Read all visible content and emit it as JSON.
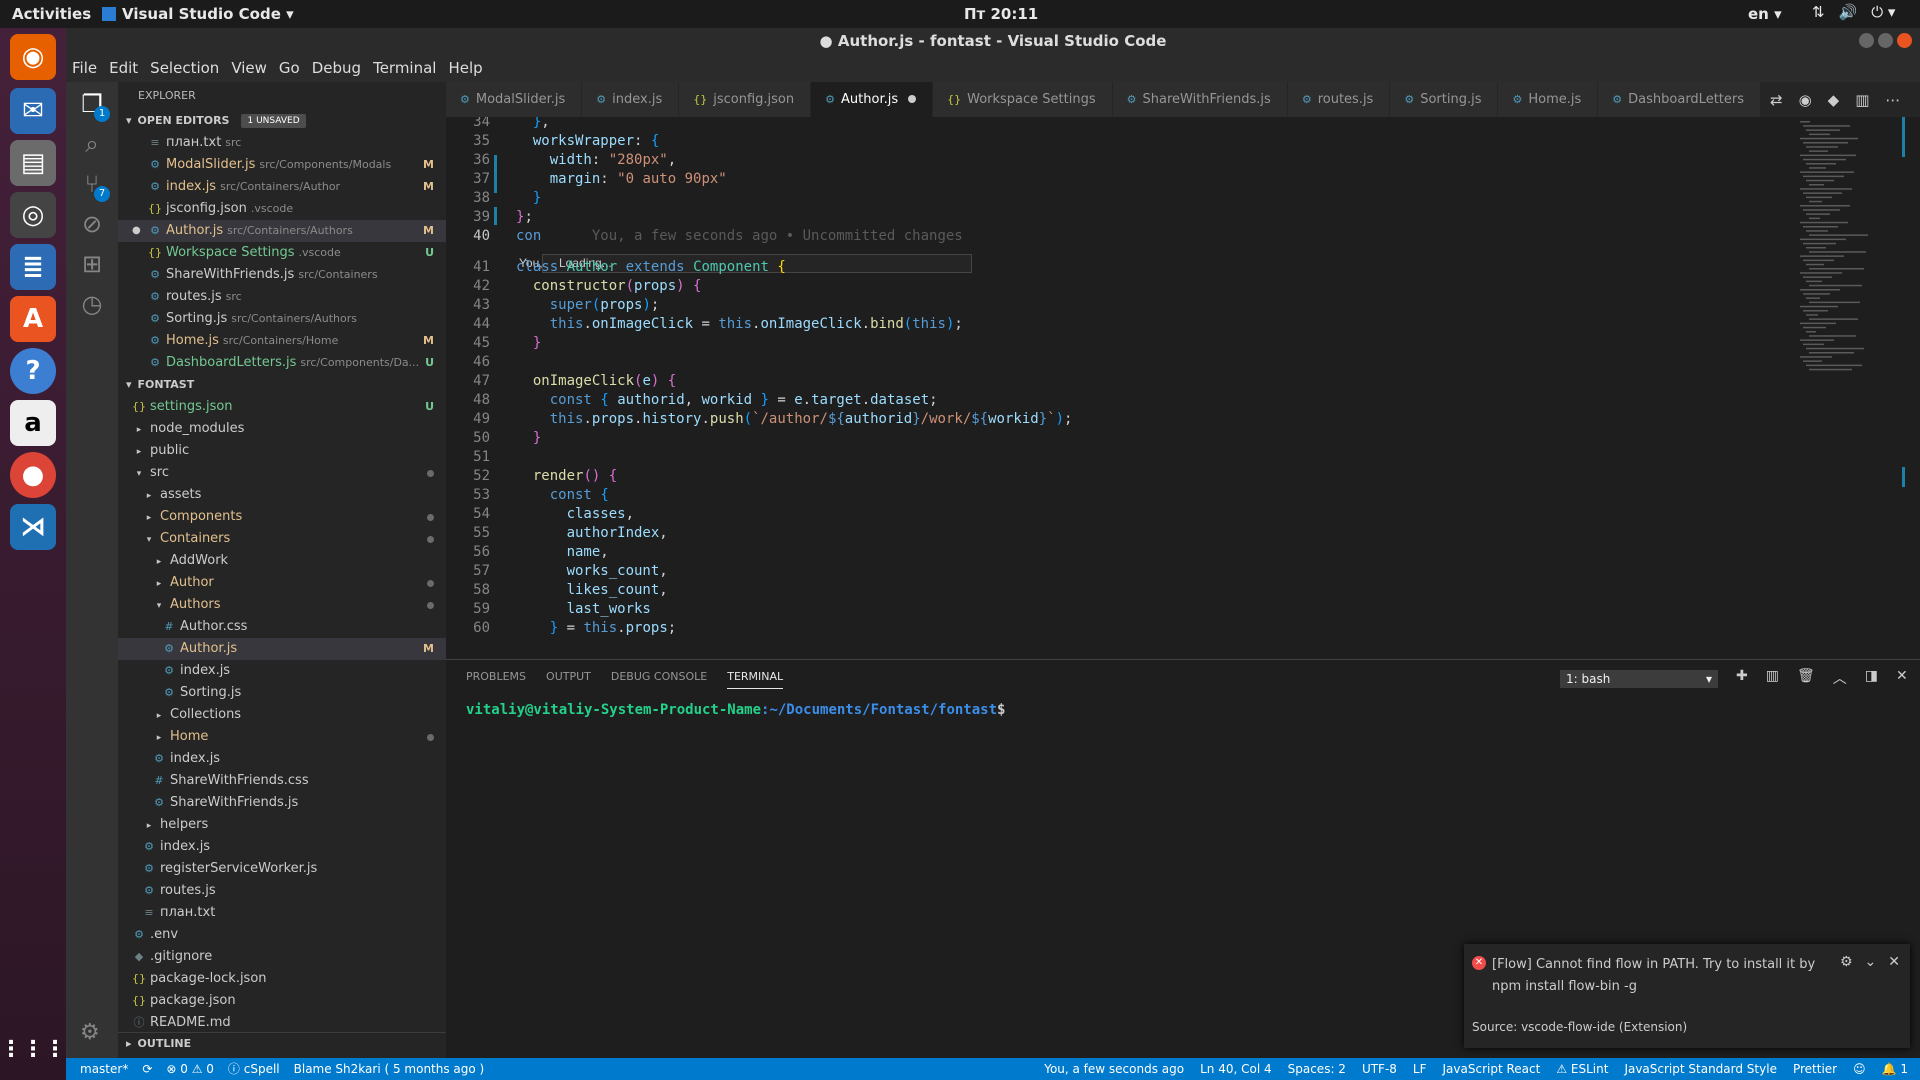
{
  "topbar": {
    "activities": "Activities",
    "app": "Visual Studio Code ▾",
    "clock": "Пт 20:11",
    "lang": "en ▾"
  },
  "window": {
    "title": "● Author.js - fontast - Visual Studio Code"
  },
  "menu": [
    "File",
    "Edit",
    "Selection",
    "View",
    "Go",
    "Debug",
    "Terminal",
    "Help"
  ],
  "activity": {
    "explorer_badge": "1",
    "scm_badge": "7"
  },
  "explorer": {
    "title": "EXPLORER",
    "open_editors_label": "OPEN EDITORS",
    "unsaved_badge": "1 UNSAVED",
    "open_editors": [
      {
        "icon": "≡",
        "name": "план.txt",
        "path": "src",
        "status": "",
        "cls": ""
      },
      {
        "icon": "⚙",
        "name": "ModalSlider.js",
        "path": "src/Components/Modals",
        "status": "M",
        "cls": "mod"
      },
      {
        "icon": "⚙",
        "name": "index.js",
        "path": "src/Containers/Author",
        "status": "M",
        "cls": "mod"
      },
      {
        "icon": "{}",
        "name": "jsconfig.json",
        "path": ".vscode",
        "status": "",
        "cls": ""
      },
      {
        "icon": "⚙",
        "name": "Author.js",
        "path": "src/Containers/Authors",
        "status": "M",
        "cls": "mod"
      },
      {
        "icon": "{}",
        "name": "Workspace Settings",
        "path": ".vscode",
        "status": "U",
        "cls": "unt"
      },
      {
        "icon": "⚙",
        "name": "ShareWithFriends.js",
        "path": "src/Containers",
        "status": "",
        "cls": ""
      },
      {
        "icon": "⚙",
        "name": "routes.js",
        "path": "src",
        "status": "",
        "cls": ""
      },
      {
        "icon": "⚙",
        "name": "Sorting.js",
        "path": "src/Containers/Authors",
        "status": "",
        "cls": ""
      },
      {
        "icon": "⚙",
        "name": "Home.js",
        "path": "src/Containers/Home",
        "status": "M",
        "cls": "mod"
      },
      {
        "icon": "⚙",
        "name": "DashboardLetters.js",
        "path": "src/Components/Da...",
        "status": "U",
        "cls": "unt"
      }
    ],
    "project_label": "FONTAST",
    "tree": [
      {
        "indent": 1,
        "icon": "{}",
        "name": "settings.json",
        "status": "U",
        "cls": "unt",
        "dot": false
      },
      {
        "indent": 1,
        "icon": "▸",
        "name": "node_modules",
        "status": "",
        "cls": "",
        "dot": false
      },
      {
        "indent": 1,
        "icon": "▸",
        "name": "public",
        "status": "",
        "cls": "",
        "dot": false
      },
      {
        "indent": 1,
        "icon": "▾",
        "name": "src",
        "status": "",
        "cls": "",
        "dot": true
      },
      {
        "indent": 2,
        "icon": "▸",
        "name": "assets",
        "status": "",
        "cls": "",
        "dot": false
      },
      {
        "indent": 2,
        "icon": "▸",
        "name": "Components",
        "status": "",
        "cls": "mod",
        "dot": true
      },
      {
        "indent": 2,
        "icon": "▾",
        "name": "Containers",
        "status": "",
        "cls": "mod",
        "dot": true
      },
      {
        "indent": 3,
        "icon": "▸",
        "name": "AddWork",
        "status": "",
        "cls": "",
        "dot": false
      },
      {
        "indent": 3,
        "icon": "▸",
        "name": "Author",
        "status": "",
        "cls": "mod",
        "dot": true
      },
      {
        "indent": 3,
        "icon": "▾",
        "name": "Authors",
        "status": "",
        "cls": "mod",
        "dot": true
      },
      {
        "indent": 4,
        "icon": "#",
        "name": "Author.css",
        "status": "",
        "cls": "",
        "dot": false
      },
      {
        "indent": 4,
        "icon": "⚙",
        "name": "Author.js",
        "status": "M",
        "cls": "mod",
        "dot": false
      },
      {
        "indent": 4,
        "icon": "⚙",
        "name": "index.js",
        "status": "",
        "cls": "",
        "dot": false
      },
      {
        "indent": 4,
        "icon": "⚙",
        "name": "Sorting.js",
        "status": "",
        "cls": "",
        "dot": false
      },
      {
        "indent": 3,
        "icon": "▸",
        "name": "Collections",
        "status": "",
        "cls": "",
        "dot": false
      },
      {
        "indent": 3,
        "icon": "▸",
        "name": "Home",
        "status": "",
        "cls": "mod",
        "dot": true
      },
      {
        "indent": 3,
        "icon": "⚙",
        "name": "index.js",
        "status": "",
        "cls": "",
        "dot": false
      },
      {
        "indent": 3,
        "icon": "#",
        "name": "ShareWithFriends.css",
        "status": "",
        "cls": "",
        "dot": false
      },
      {
        "indent": 3,
        "icon": "⚙",
        "name": "ShareWithFriends.js",
        "status": "",
        "cls": "",
        "dot": false
      },
      {
        "indent": 2,
        "icon": "▸",
        "name": "helpers",
        "status": "",
        "cls": "",
        "dot": false
      },
      {
        "indent": 2,
        "icon": "⚙",
        "name": "index.js",
        "status": "",
        "cls": "",
        "dot": false
      },
      {
        "indent": 2,
        "icon": "⚙",
        "name": "registerServiceWorker.js",
        "status": "",
        "cls": "",
        "dot": false
      },
      {
        "indent": 2,
        "icon": "⚙",
        "name": "routes.js",
        "status": "",
        "cls": "",
        "dot": false
      },
      {
        "indent": 2,
        "icon": "≡",
        "name": "план.txt",
        "status": "",
        "cls": "",
        "dot": false
      },
      {
        "indent": 1,
        "icon": "⚙",
        "name": ".env",
        "status": "",
        "cls": "",
        "dot": false
      },
      {
        "indent": 1,
        "icon": "◆",
        "name": ".gitignore",
        "status": "",
        "cls": "",
        "dot": false
      },
      {
        "indent": 1,
        "icon": "{}",
        "name": "package-lock.json",
        "status": "",
        "cls": "",
        "dot": false
      },
      {
        "indent": 1,
        "icon": "{}",
        "name": "package.json",
        "status": "",
        "cls": "",
        "dot": false
      },
      {
        "indent": 1,
        "icon": "ⓘ",
        "name": "README.md",
        "status": "",
        "cls": "",
        "dot": false
      }
    ],
    "outline_label": "OUTLINE"
  },
  "tabs": [
    {
      "icon": "⚙",
      "label": "ModalSlider.js",
      "active": false
    },
    {
      "icon": "⚙",
      "label": "index.js",
      "active": false
    },
    {
      "icon": "{}",
      "label": "jsconfig.json",
      "active": false
    },
    {
      "icon": "⚙",
      "label": "Author.js",
      "active": true
    },
    {
      "icon": "{}",
      "label": "Workspace Settings",
      "active": false
    },
    {
      "icon": "⚙",
      "label": "ShareWithFriends.js",
      "active": false
    },
    {
      "icon": "⚙",
      "label": "routes.js",
      "active": false
    },
    {
      "icon": "⚙",
      "label": "Sorting.js",
      "active": false
    },
    {
      "icon": "⚙",
      "label": "Home.js",
      "active": false
    },
    {
      "icon": "⚙",
      "label": "DashboardLetters",
      "active": false
    }
  ],
  "editor": {
    "current_line": 40,
    "lines": [
      {
        "n": 34,
        "html": "  <span class='br2'>}</span>,"
      },
      {
        "n": 35,
        "html": "  <span class='p'>worksWrapper</span>: <span class='br2'>{</span>"
      },
      {
        "n": 36,
        "html": "    <span class='p'>width</span>: <span class='s'>\"280px\"</span>,"
      },
      {
        "n": 37,
        "html": "    <span class='p'>margin</span>: <span class='s'>\"0 auto 90px\"</span>"
      },
      {
        "n": 38,
        "html": "  <span class='br2'>}</span>"
      },
      {
        "n": 39,
        "html": "<span class='br1'>}</span>;"
      },
      {
        "n": 40,
        "html": "<span class='k'>con</span>      <span class='ghost'>You, a few seconds ago • Uncommitted changes</span>"
      },
      {
        "n": 41,
        "html": "<span class='k'>class</span> <span class='c'>Author</span> <span class='k'>extends</span> <span class='c'>Component</span> <span class='br3'>{</span>"
      },
      {
        "n": 42,
        "html": "  <span class='f'>constructor</span><span class='br1'>(</span><span class='p'>props</span><span class='br1'>)</span> <span class='br1'>{</span>"
      },
      {
        "n": 43,
        "html": "    <span class='k'>super</span><span class='br2'>(</span><span class='p'>props</span><span class='br2'>)</span>;"
      },
      {
        "n": 44,
        "html": "    <span class='k'>this</span>.<span class='p'>onImageClick</span> = <span class='k'>this</span>.<span class='p'>onImageClick</span>.<span class='f'>bind</span><span class='br2'>(</span><span class='k'>this</span><span class='br2'>)</span>;"
      },
      {
        "n": 45,
        "html": "  <span class='br1'>}</span>"
      },
      {
        "n": 46,
        "html": ""
      },
      {
        "n": 47,
        "html": "  <span class='f'>onImageClick</span><span class='br1'>(</span><span class='p'>e</span><span class='br1'>)</span> <span class='br1'>{</span>"
      },
      {
        "n": 48,
        "html": "    <span class='k'>const</span> <span class='br2'>{</span> <span class='p'>authorid</span>, <span class='p'>workid</span> <span class='br2'>}</span> = <span class='p'>e</span>.<span class='p'>target</span>.<span class='p'>dataset</span>;"
      },
      {
        "n": 49,
        "html": "    <span class='k'>this</span>.<span class='p'>props</span>.<span class='p'>history</span>.<span class='f'>push</span><span class='br2'>(</span><span class='s'>`/author/</span><span class='k'>${</span><span class='p'>authorid</span><span class='k'>}</span><span class='s'>/work/</span><span class='k'>${</span><span class='p'>workid</span><span class='k'>}</span><span class='s'>`</span><span class='br2'>)</span>;"
      },
      {
        "n": 50,
        "html": "  <span class='br1'>}</span>"
      },
      {
        "n": 51,
        "html": ""
      },
      {
        "n": 52,
        "html": "  <span class='f'>render</span><span class='br1'>()</span> <span class='br1'>{</span>"
      },
      {
        "n": 53,
        "html": "    <span class='k'>const</span> <span class='br2'>{</span>"
      },
      {
        "n": 54,
        "html": "      <span class='p'>classes</span>,"
      },
      {
        "n": 55,
        "html": "      <span class='p'>authorIndex</span>,"
      },
      {
        "n": 56,
        "html": "      <span class='p'>name</span>,"
      },
      {
        "n": 57,
        "html": "      <span class='p'>works_count</span>,"
      },
      {
        "n": 58,
        "html": "      <span class='p'>likes_count</span>,"
      },
      {
        "n": 59,
        "html": "      <span class='p'>last_works</span>"
      },
      {
        "n": 60,
        "html": "    <span class='br2'>}</span> = <span class='k'>this</span>.<span class='p'>props</span>;"
      }
    ],
    "hover_prefix": "You,",
    "hover_text": "Loading..."
  },
  "panel": {
    "tabs": [
      "PROBLEMS",
      "OUTPUT",
      "DEBUG CONSOLE",
      "TERMINAL"
    ],
    "active_tab": "TERMINAL",
    "shell_select": "1: bash",
    "prompt_user": "vitaliy@vitaliy-System-Product-Name",
    "prompt_path": ":~/Documents/Fontast/fontast",
    "prompt_end": "$"
  },
  "notification": {
    "message": "[Flow] Cannot find flow in PATH. Try to install it by npm install flow-bin -g",
    "source": "Source: vscode-flow-ide (Extension)"
  },
  "statusbar": {
    "left": [
      "master*",
      "⟳",
      "⊗ 0 ⚠ 0",
      "ⓘ cSpell",
      "Blame Sh2kari ( 5 months ago )"
    ],
    "right": [
      "You, a few seconds ago",
      "Ln 40, Col 4",
      "Spaces: 2",
      "UTF-8",
      "LF",
      "JavaScript React",
      "⚠ ESLint",
      "JavaScript Standard Style",
      "Prettier",
      "☺",
      "🔔 1"
    ]
  }
}
